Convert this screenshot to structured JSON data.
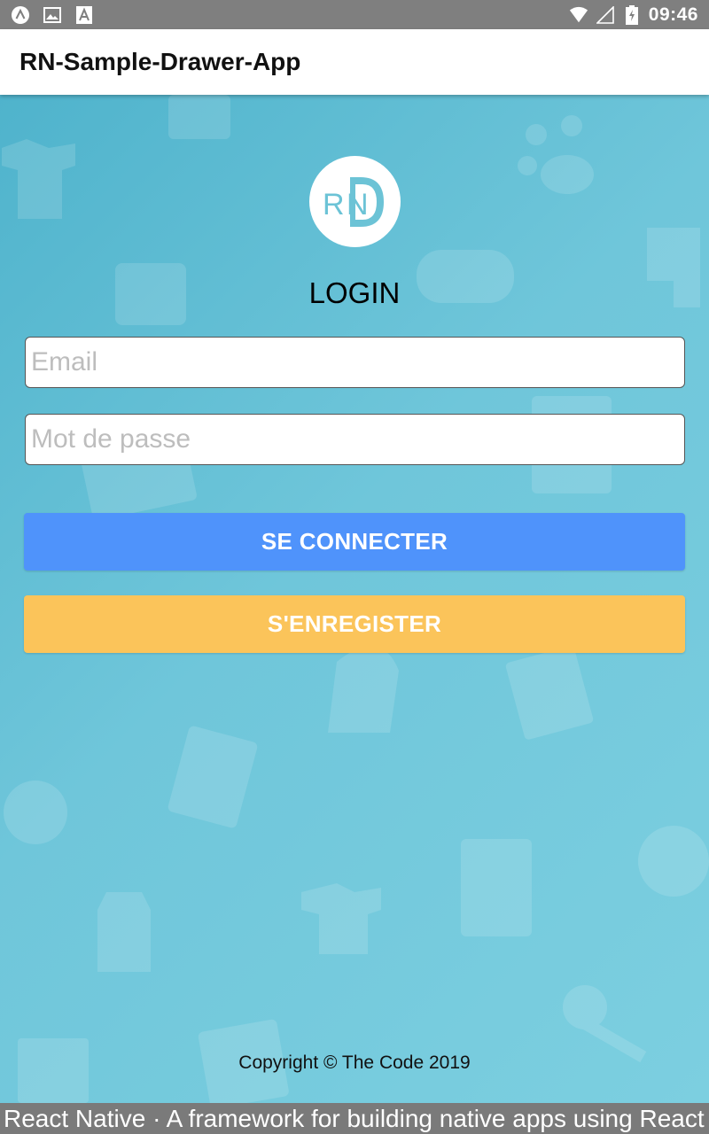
{
  "status_bar": {
    "time": "09:46",
    "icons": [
      "app-a-icon",
      "image-icon",
      "font-a-icon",
      "wifi-icon",
      "signal-icon",
      "battery-charging-icon"
    ]
  },
  "app_bar": {
    "title": "RN-Sample-Drawer-App"
  },
  "login": {
    "logo_icon": "rn-logo",
    "title": "LOGIN",
    "email_placeholder": "Email",
    "email_value": "",
    "password_placeholder": "Mot de passe",
    "password_value": "",
    "login_button": "SE CONNECTER",
    "register_button": "S'ENREGISTER",
    "copyright": "Copyright © The Code 2019"
  },
  "footer": {
    "text": "React Native · A framework for building native apps using React"
  },
  "colors": {
    "background": "#6cc3d6",
    "login_button": "#4f93fb",
    "register_button": "#fbc45a",
    "app_bar": "#ffffff",
    "status_bar": "#7f7f7f"
  }
}
